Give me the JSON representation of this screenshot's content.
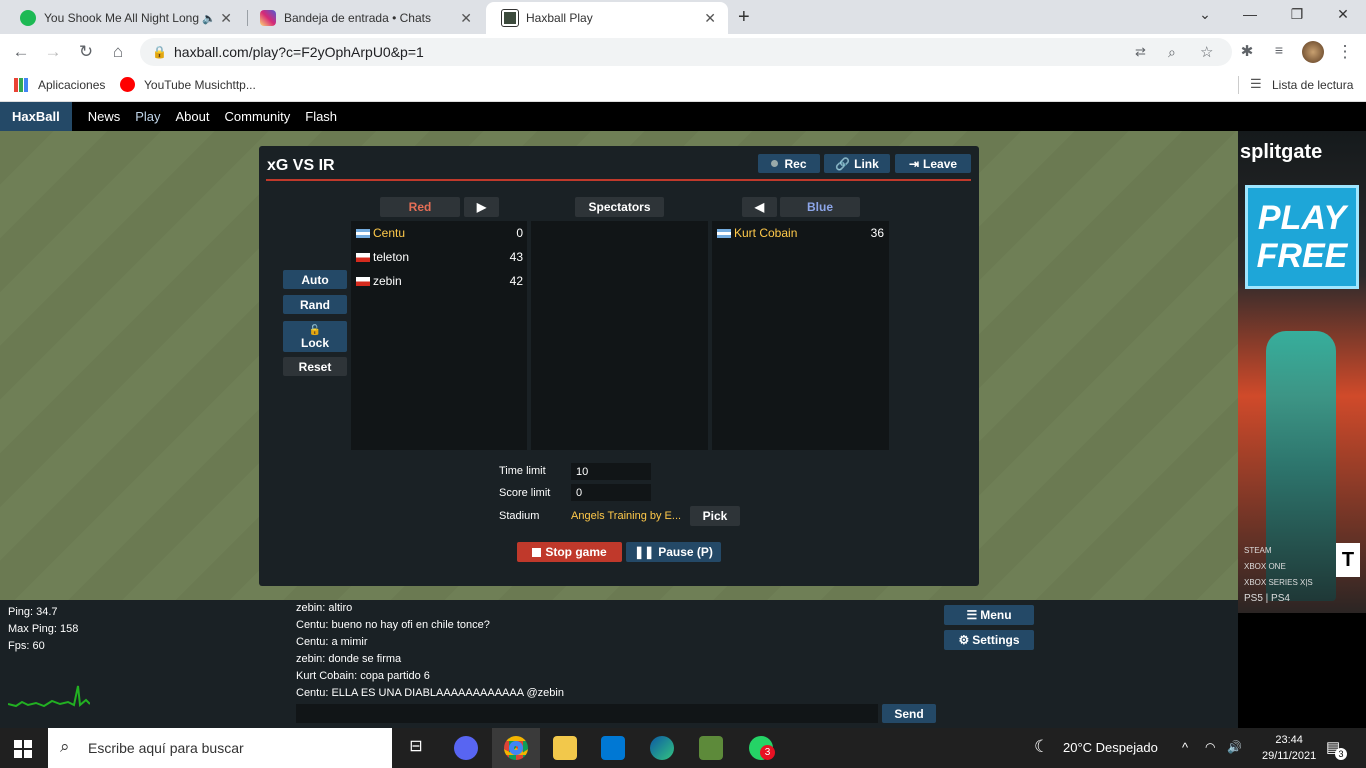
{
  "browser": {
    "tabs": [
      {
        "title": "You Shook Me All Night Long",
        "icon": "spotify-icon",
        "color": "#1db954"
      },
      {
        "title": "Bandeja de entrada • Chats",
        "icon": "instagram-icon",
        "color": "#d62976"
      },
      {
        "title": "Haxball Play",
        "icon": "haxball-icon",
        "color": "#3c4a3c"
      }
    ],
    "url": "haxball.com/play?c=F2yOphArpU0&p=1",
    "bookmarks": [
      {
        "label": "Aplicaciones",
        "icon": "apps-grid-icon"
      },
      {
        "label": "YouTube Musichttp...",
        "icon": "youtube-music-icon"
      }
    ],
    "reading_list": "Lista de lectura"
  },
  "site_nav": {
    "logo": "HaxBall",
    "links": [
      "News",
      "Play",
      "About",
      "Community",
      "Flash"
    ]
  },
  "room": {
    "title": "xG VS IR",
    "rec": "Rec",
    "link": "Link",
    "leave": "Leave",
    "red_label": "Red",
    "spectators_label": "Spectators",
    "blue_label": "Blue",
    "auto": "Auto",
    "rand": "Rand",
    "lock": "Lock",
    "reset": "Reset",
    "red_players": [
      {
        "name": "Centu",
        "score": "0",
        "flag": "argentina-flag"
      },
      {
        "name": "teleton",
        "score": "43",
        "flag": "chile-flag"
      },
      {
        "name": "zebin",
        "score": "42",
        "flag": "chile-flag"
      }
    ],
    "blue_players": [
      {
        "name": "Kurt Cobain",
        "score": "36",
        "flag": "argentina-flag"
      }
    ],
    "time_limit_label": "Time limit",
    "time_limit": "10",
    "score_limit_label": "Score limit",
    "score_limit": "0",
    "stadium_label": "Stadium",
    "stadium": "Angels Training by E...",
    "pick": "Pick",
    "stop_game": "Stop game",
    "pause": "Pause (P)",
    "accent": "#c0392b"
  },
  "stats": {
    "ping": "Ping: 34.7",
    "max_ping": "Max Ping: 158",
    "fps": "Fps: 60"
  },
  "chat": {
    "messages": [
      "zebin: altiro",
      "Centu: bueno no hay ofi en chile tonce?",
      "Centu: a mimir",
      "zebin: donde se firma",
      "Kurt Cobain: copa partido 6",
      "Centu: ELLA ES UNA DIABLAAAAAAAAAAAA @zebin"
    ],
    "input_value": "",
    "send": "Send"
  },
  "menu": {
    "menu_label": "Menu",
    "settings_label": "Settings"
  },
  "ad": {
    "brand": "splitgate",
    "cta_line1": "PLAY",
    "cta_line2": "FREE",
    "platforms": [
      "STEAM",
      "XBOX ONE",
      "XBOX SERIES X|S",
      "PS5 | PS4"
    ],
    "rating": "T"
  },
  "taskbar": {
    "search_placeholder": "Escribe aquí para buscar",
    "weather": "20°C  Despejado",
    "time": "23:44",
    "date": "29/11/2021",
    "notifications": "3",
    "whatsapp_badge": "3"
  }
}
